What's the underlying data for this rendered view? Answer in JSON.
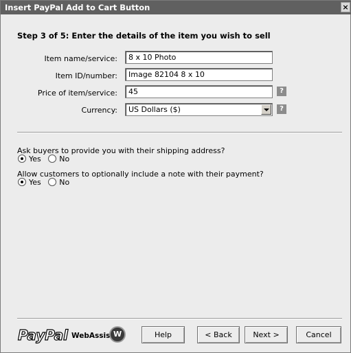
{
  "window": {
    "title": "Insert PayPal Add to Cart Button",
    "close_label": "×"
  },
  "step_title": "Step 3 of 5: Enter the details of the item you wish to sell",
  "fields": {
    "item_name_label": "Item name/service:",
    "item_name_value": "8 x 10  Photo",
    "item_id_label": "Item ID/number:",
    "item_id_value": "Image 82104 8 x 10",
    "price_label": "Price of item/service:",
    "price_value": "45",
    "currency_label": "Currency:",
    "currency_value": "US Dollars ($)",
    "help_mark": "?"
  },
  "shipping": {
    "question": "Ask buyers to provide you with their shipping address?",
    "yes_label": "Yes",
    "no_label": "No",
    "selected": "Yes"
  },
  "note": {
    "question": "Allow customers to optionally include a note with their payment?",
    "yes_label": "Yes",
    "no_label": "No",
    "selected": "Yes"
  },
  "footer": {
    "paypal_logo_text": "PayPal",
    "webassist_text": "WebAssist",
    "help_button": "Help",
    "back_button": "< Back",
    "next_button": "Next >",
    "cancel_button": "Cancel"
  },
  "icons": {
    "close": "close-icon",
    "help": "question-help-icon",
    "dropdown": "chevron-down-icon",
    "webassist": "webassist-logo-icon"
  },
  "colors": {
    "titlebar": "#606060",
    "dialog_bg": "#ececec",
    "help_badge": "#8c8c8c"
  }
}
